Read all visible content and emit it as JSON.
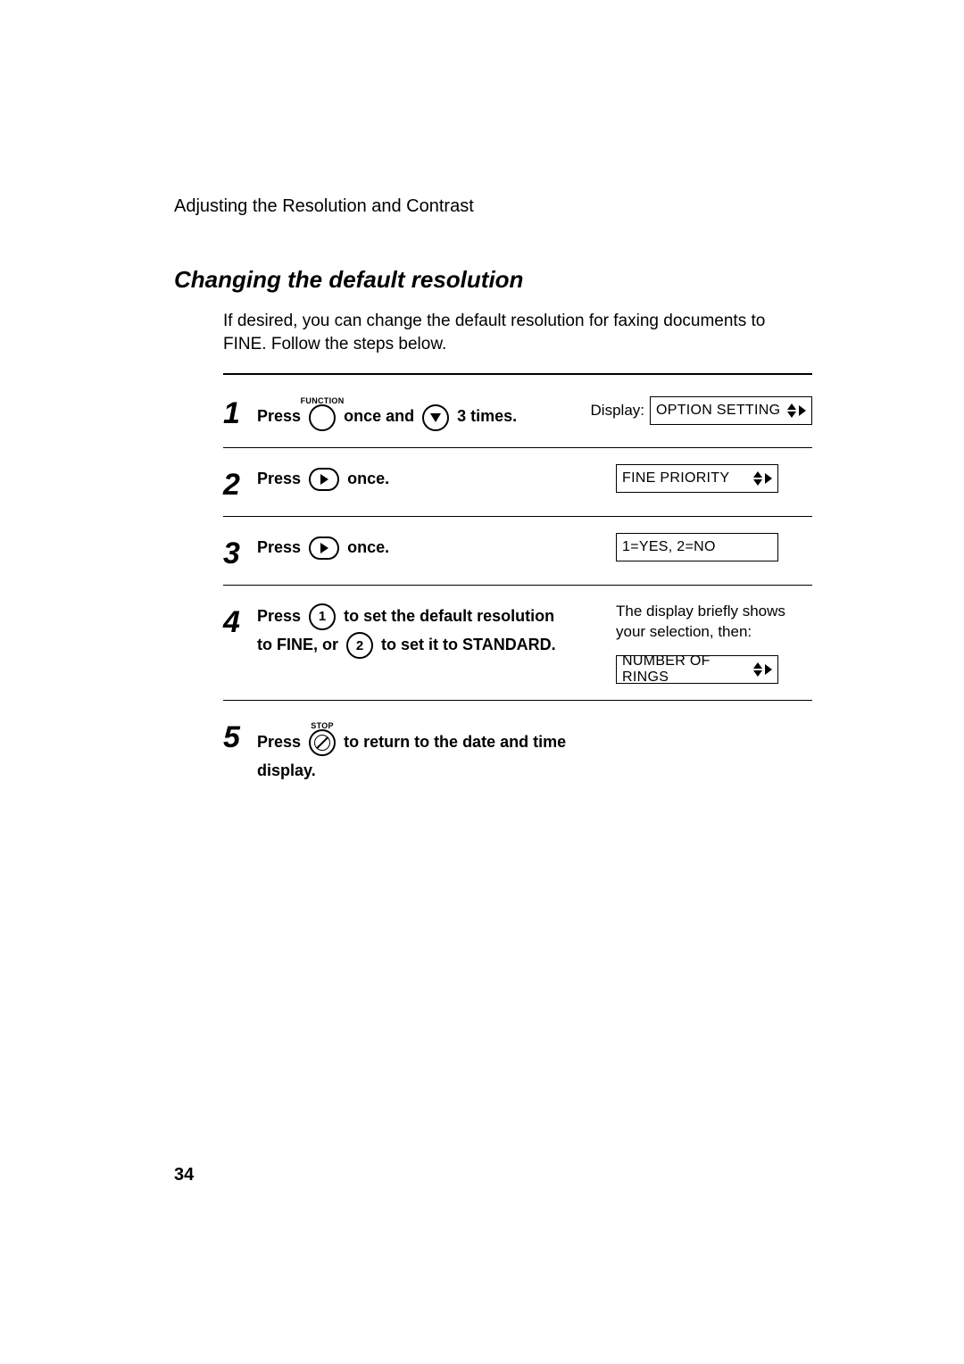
{
  "header": "Adjusting the Resolution and Contrast",
  "section_title": "Changing the default resolution",
  "intro": "If desired, you can change the default resolution for faxing documents to FINE. Follow the steps below.",
  "display_label": "Display:",
  "steps": {
    "s1": {
      "num": "1",
      "press": "Press",
      "function_label": "FUNCTION",
      "mid": "once and",
      "tail": "3 times.",
      "lcd": "OPTION SETTING"
    },
    "s2": {
      "num": "2",
      "press": "Press",
      "tail": "once.",
      "lcd": "FINE PRIORITY"
    },
    "s3": {
      "num": "3",
      "press": "Press",
      "tail": "once.",
      "lcd": "1=YES, 2=NO"
    },
    "s4": {
      "num": "4",
      "press": "Press",
      "part1_tail": "to set the default resolution",
      "line2_a": "to FINE, or",
      "line2_b": "to set it to STANDARD.",
      "note": "The display briefly shows your selection, then:",
      "lcd": "NUMBER OF RINGS",
      "key1": "1",
      "key2": "2"
    },
    "s5": {
      "num": "5",
      "press": "Press",
      "stop_label": "STOP",
      "tail": "to return to the date and time display."
    }
  },
  "page_number": "34"
}
